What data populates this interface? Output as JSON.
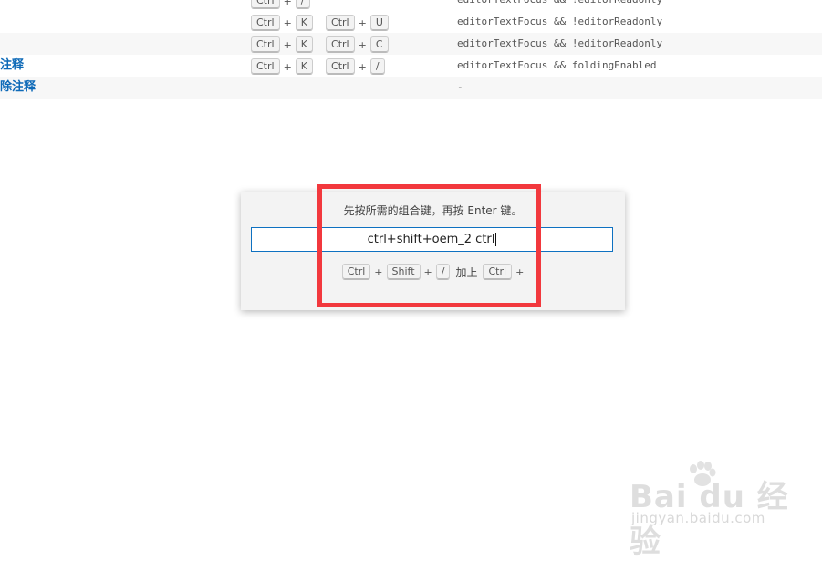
{
  "rows": [
    {
      "command": "",
      "keys": [
        [
          "Ctrl",
          "/"
        ]
      ],
      "when": "editorTextFocus && !editorReadonly"
    },
    {
      "command": "",
      "keys": [
        [
          "Ctrl",
          "K"
        ],
        [
          "Ctrl",
          "U"
        ]
      ],
      "when": "editorTextFocus && !editorReadonly"
    },
    {
      "command": "",
      "keys": [
        [
          "Ctrl",
          "K"
        ],
        [
          "Ctrl",
          "C"
        ]
      ],
      "when": "editorTextFocus && !editorReadonly"
    },
    {
      "command": "注释",
      "keys": [
        [
          "Ctrl",
          "K"
        ],
        [
          "Ctrl",
          "/"
        ]
      ],
      "when": "editorTextFocus && foldingEnabled"
    },
    {
      "command": "除注释",
      "keys": [],
      "when": "-"
    }
  ],
  "dialog": {
    "message": "先按所需的组合键，再按 Enter 键。",
    "input_value": "ctrl+shift+oem_2 ctrl",
    "preview": {
      "first_chord": [
        "Ctrl",
        "Shift",
        "/"
      ],
      "joiner": "加上",
      "second_chord": [
        "Ctrl"
      ]
    }
  },
  "watermark": {
    "logo_text": "Bai du 经验",
    "site": "jingyan.baidu.com"
  },
  "colors": {
    "command_link": "#0e6ab8",
    "highlight": "#f2383d",
    "input_border": "#0e71c1"
  }
}
